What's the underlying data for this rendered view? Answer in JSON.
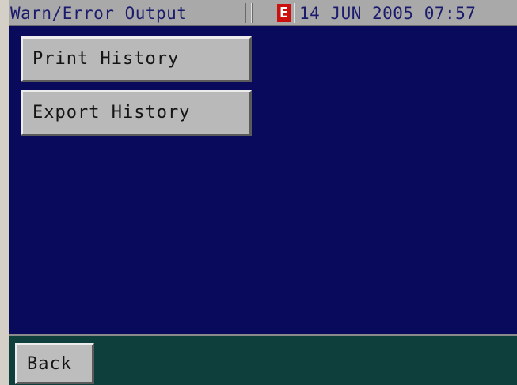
{
  "header": {
    "title": "Warn/Error Output",
    "error_indicator": "E",
    "datetime": "14 JUN 2005 07:57"
  },
  "main": {
    "print_history_label": "Print History",
    "export_history_label": "Export History"
  },
  "footer": {
    "back_label": "Back"
  },
  "colors": {
    "background": "#0a0a5c",
    "title_bar": "#a9a9a9",
    "footer": "#0f3f3d",
    "button_face": "#b9b9b9",
    "error_badge": "#cc1010"
  }
}
